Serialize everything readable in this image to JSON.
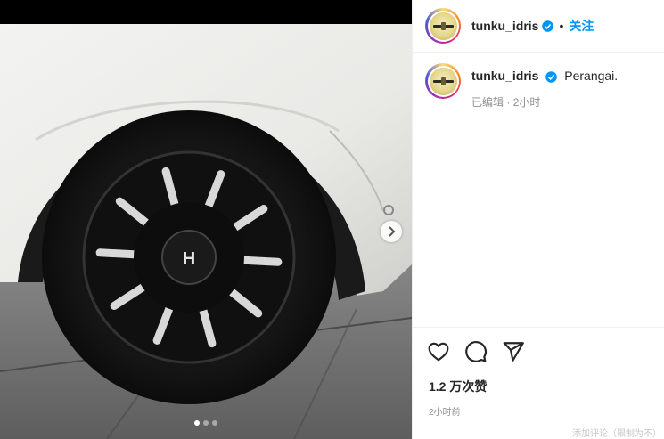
{
  "post": {
    "username": "tunku_idris",
    "follow_label": "关注",
    "separator": "•",
    "caption": "Perangai.",
    "caption_meta": "已编辑 · 2小时",
    "likes": "1.2 万次赞",
    "posted_time": "2小时前",
    "comment_hint": "添加评论（限制为不）"
  },
  "carousel": {
    "total": 3,
    "active": 1
  },
  "icons": {
    "verified": "verified-badge-icon",
    "like": "heart-icon",
    "comment": "comment-icon",
    "share": "share-icon",
    "next": "chevron-right-icon"
  },
  "colors": {
    "accent": "#0095f6",
    "text": "#262626",
    "muted": "#8e8e8e",
    "border": "#efefef"
  }
}
